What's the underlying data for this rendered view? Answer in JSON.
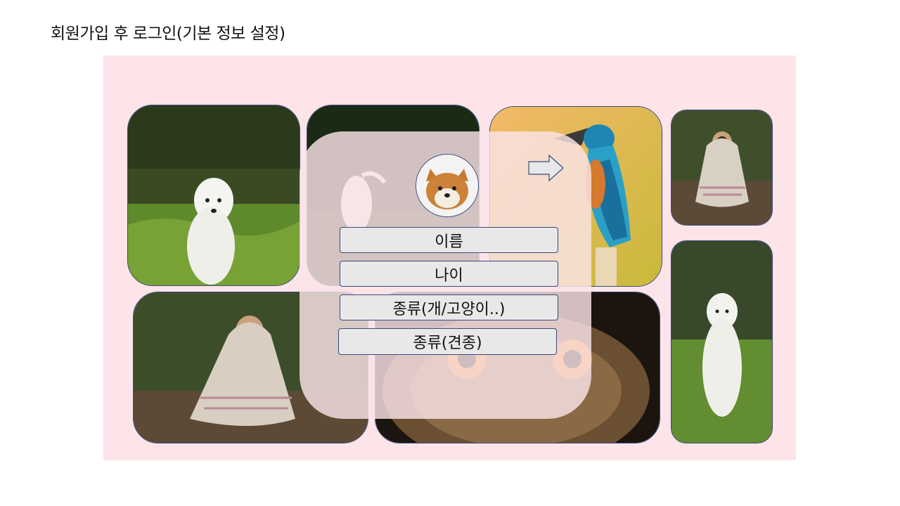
{
  "slide": {
    "title": "회원가입 후 로그인(기본 정보 설정)"
  },
  "form": {
    "name_field": "이름",
    "age_field": "나이",
    "species_field": "종류(개/고양이..)",
    "breed_field": "종류(견종)"
  },
  "colors": {
    "background_panel": "#fde4e8",
    "card_overlay": "#fae4e8",
    "field_fill": "#e8e8e8",
    "border": "#3b4a7a"
  },
  "icons": {
    "next": "right-arrow-icon",
    "profile": "avatar-shiba-icon"
  }
}
